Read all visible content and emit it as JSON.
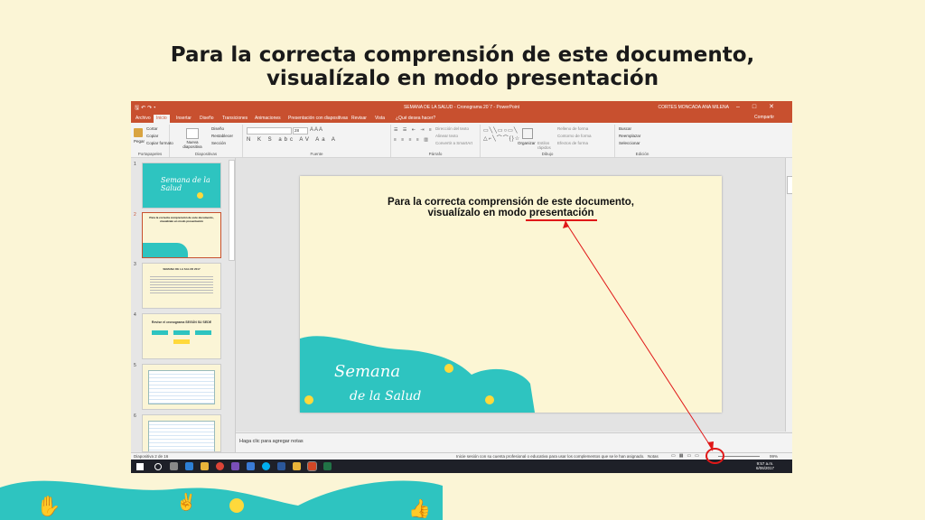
{
  "slide": {
    "title_line1": "Para la correcta comprensión de este documento,",
    "title_line2": "visualízalo en modo presentación"
  },
  "window": {
    "title": "SEMANA DE LA SALUD - Cronograma 20`7 - PowerPoint",
    "user": "CORTES MONCADA ANA MILENA",
    "tabs": [
      "Archivo",
      "Inicio",
      "Insertar",
      "Diseño",
      "Transiciones",
      "Animaciones",
      "Presentación con diapositivas",
      "Revisar",
      "Vista",
      "¿Qué desea hacer?"
    ],
    "active_tab": "Inicio",
    "share": "Compartir"
  },
  "ribbon": {
    "clipboard": {
      "paste": "Pegar",
      "cut": "Cortar",
      "copy": "Copiar",
      "format": "Copiar formato",
      "label": "Portapapeles"
    },
    "slides": {
      "new": "Nueva diapositiva",
      "layout": "Diseño",
      "reset": "Restablecer",
      "section": "Sección",
      "label": "Diapositivas"
    },
    "font": {
      "size": "28",
      "label": "Fuente"
    },
    "paragraph": {
      "text_dir": "Dirección del texto",
      "align": "Alinear texto",
      "smartart": "Convertir a SmartArt",
      "label": "Párrafo"
    },
    "drawing": {
      "arrange": "Organizar",
      "styles": "Estilos rápidos",
      "fill": "Relleno de forma",
      "outline": "Contorno de forma",
      "effects": "Efectos de forma",
      "label": "Dibujo"
    },
    "editing": {
      "find": "Buscar",
      "replace": "Reemplazar",
      "select": "Seleccionar",
      "label": "Edición"
    }
  },
  "thumbnails": [
    {
      "num": "1",
      "text": "Semana de la Salud"
    },
    {
      "num": "2",
      "text": "Para la correcta comprensión de este documento, visualízalo en modo presentación"
    },
    {
      "num": "3",
      "text": "SEMANA DE LA SALUD 2017"
    },
    {
      "num": "4",
      "text": "Revise el cronograma SEGÚN SU SEDE"
    },
    {
      "num": "5",
      "text": ""
    },
    {
      "num": "6",
      "text": ""
    }
  ],
  "main_slide": {
    "title_line1": "Para la correcta comprensión de este documento,",
    "title_line2": "visualízalo en modo presentación",
    "logo_line1": "Semana",
    "logo_line2": "de la Salud"
  },
  "notes_placeholder": "Haga clic para agregar notas",
  "status": {
    "slide_info": "Diapositiva 2 de 16",
    "message": "Inicie sesión con su cuenta profesional o educativa para usar los complementos que se le han asignado.",
    "notes_btn": "Notas",
    "zoom": "99%"
  },
  "taskbar": {
    "time": "9:57 a.m.",
    "date": "6/06/2017"
  },
  "colors": {
    "accent": "#C8502F",
    "teal": "#2EC4C0",
    "background": "#FBF5D6",
    "highlight": "#E01818"
  }
}
